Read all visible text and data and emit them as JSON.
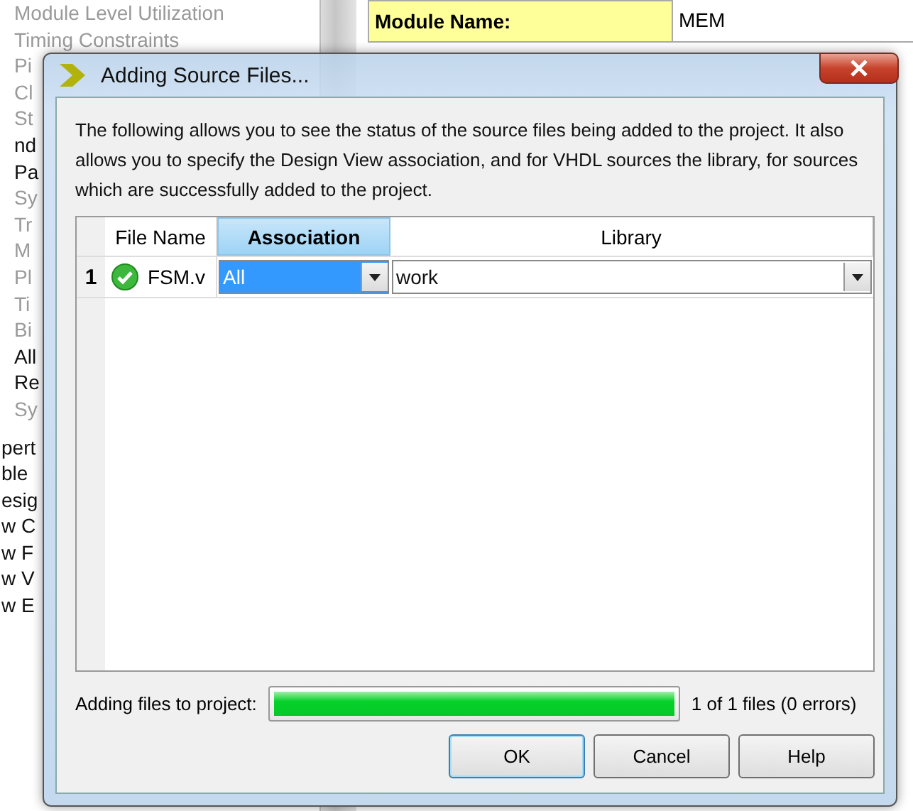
{
  "background": {
    "sidebar": [
      {
        "label": "Module Level Utilization",
        "dim": true
      },
      {
        "label": "Timing Constraints",
        "dim": true
      },
      {
        "label": "Pi",
        "dim": true
      },
      {
        "label": "Cl",
        "dim": true
      },
      {
        "label": "St",
        "dim": true
      },
      {
        "label": "nd",
        "dim": false
      },
      {
        "label": "Pa",
        "dim": false
      },
      {
        "label": "Sy",
        "dim": true
      },
      {
        "label": "Tr",
        "dim": true
      },
      {
        "label": "M",
        "dim": true
      },
      {
        "label": "Pl",
        "dim": true
      },
      {
        "label": "Ti",
        "dim": true
      },
      {
        "label": "Bi",
        "dim": true
      },
      {
        "label": "All",
        "dim": false
      },
      {
        "label": "Re",
        "dim": false
      },
      {
        "label": "Sy",
        "dim": true
      }
    ],
    "panel": [
      {
        "label": "pert"
      },
      {
        "label": "ble"
      },
      {
        "label": "esig"
      },
      {
        "label": "w C"
      },
      {
        "label": "w F"
      },
      {
        "label": "w V"
      },
      {
        "label": "w E"
      }
    ],
    "summary": {
      "label": "Module Name:",
      "value": "MEM"
    }
  },
  "dialog": {
    "title": "Adding Source Files...",
    "description": "The following allows you to see the status of the source files being added to the project.  It also allows you to specify the Design View association, and for VHDL sources the library, for sources which are successfully added to the project.",
    "table": {
      "columns": [
        {
          "label": "File Name",
          "selected": false
        },
        {
          "label": "Association",
          "selected": true
        },
        {
          "label": "Library",
          "selected": false
        }
      ],
      "rows": [
        {
          "number": "1",
          "file": "FSM.v",
          "association": "All",
          "association_selected": true,
          "library": "work"
        }
      ]
    },
    "progress": {
      "label": "Adding files to project:",
      "level": 1,
      "reading": "1 of 1 files (0 errors)"
    },
    "buttons": [
      {
        "label": "OK",
        "default": true
      },
      {
        "label": "Cancel",
        "default": false
      },
      {
        "label": "Help",
        "default": false
      }
    ]
  }
}
